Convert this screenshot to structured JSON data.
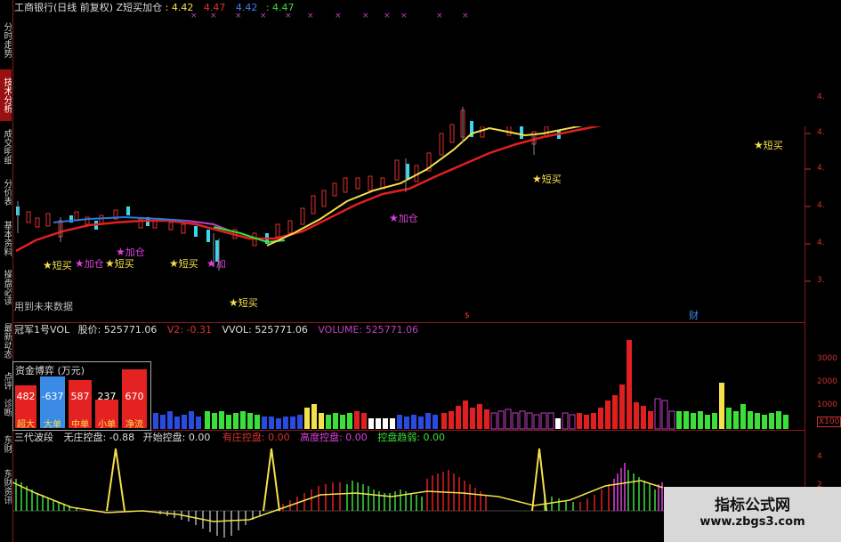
{
  "header": {
    "stock": "工商银行(日线 前复权)",
    "indicator": "Z短买加仓",
    "v1": ": 4.42",
    "v2": "4.47",
    "v3": "4.42",
    "v4": ": 4.47"
  },
  "sidebar": {
    "tabs": [
      "分时走势",
      "技术分析",
      "成交明细",
      "分价表",
      "基本资料",
      "操盘必读",
      "最新动态",
      "点评",
      "诊断",
      "东财",
      "东财资讯"
    ]
  },
  "main_chart": {
    "future_note": "用到未来数据",
    "axis_labels": [
      "4.",
      "4.",
      "4.",
      "3.",
      "4.",
      "4."
    ],
    "markers": [
      {
        "text": "短买",
        "color": "#f4e04a"
      },
      {
        "text": "加仓",
        "color": "#e040e0"
      },
      {
        "text": "短买",
        "color": "#f4e04a"
      },
      {
        "text": "加仓",
        "color": "#e040e0"
      },
      {
        "text": "短买",
        "color": "#f4e04a"
      },
      {
        "text": "加",
        "color": "#e040e0"
      },
      {
        "text": "短买",
        "color": "#f4e04a"
      },
      {
        "text": "加仓",
        "color": "#e040e0"
      },
      {
        "text": "短买",
        "color": "#f4e04a"
      },
      {
        "text": "短买",
        "color": "#f4e04a"
      }
    ],
    "event_labels": [
      "$",
      "财"
    ]
  },
  "volume_panel": {
    "name": "冠军1号VOL",
    "price_label": "股价: 525771.06",
    "v2_label": "V2: -0.31",
    "vvol_label": "VVOL: 525771.06",
    "volume_label": "VOLUME: 525771.06",
    "axis_labels": [
      "3000",
      "2000",
      "1000",
      "X100"
    ],
    "fund_box": {
      "title": "资金博弈 (万元)",
      "values": [
        "482",
        "-637",
        "587",
        "237",
        "670"
      ],
      "labels": [
        "超大",
        "大单",
        "中单",
        "小单",
        "净流"
      ],
      "colors": [
        "#e52222",
        "#3a8ae6",
        "#e52222",
        "#e52222",
        "#e52222"
      ]
    }
  },
  "wave_panel": {
    "name": "三代波段",
    "items": [
      {
        "label": "无庄控盘: -0.88",
        "color": "#dddddd"
      },
      {
        "label": "开始控盘: 0.00",
        "color": "#dddddd"
      },
      {
        "label": "有庄控盘: 0.00",
        "color": "#e03030"
      },
      {
        "label": "高度控盘: 0.00",
        "color": "#e040e0"
      },
      {
        "label": "控盘趋弱: 0.00",
        "color": "#3adf3a"
      }
    ],
    "axis_labels": [
      "4",
      "2"
    ]
  },
  "watermark": {
    "title": "指标公式网",
    "url": "www.zbgs3.com"
  }
}
